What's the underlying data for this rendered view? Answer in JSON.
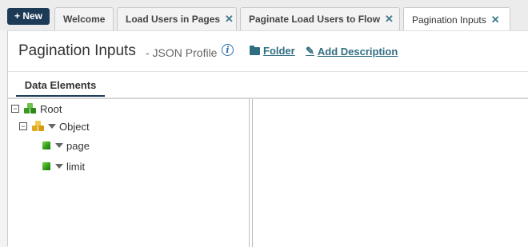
{
  "toolbar": {
    "new_label": "+ New"
  },
  "tabs": [
    {
      "label": "Welcome",
      "closable": false
    },
    {
      "label": "Load Users in Pages",
      "closable": true
    },
    {
      "label": "Paginate Load Users to Flow",
      "closable": true
    },
    {
      "label": "Pagination Inputs",
      "closable": true,
      "active": true
    }
  ],
  "close_glyph": "✕",
  "header": {
    "title": "Pagination Inputs",
    "subtitle": "- JSON Profile",
    "info_glyph": "i",
    "folder_link": "Folder",
    "add_description_link": "Add Description"
  },
  "subtabs": [
    {
      "label": "Data Elements"
    }
  ],
  "tree": {
    "root": {
      "label": "Root",
      "icon": "green-cubes-icon",
      "expanded": true
    },
    "object": {
      "label": "Object",
      "icon": "yellow-cubes-icon",
      "expanded": true
    },
    "fields": [
      {
        "label": "page",
        "icon": "green-cube-icon"
      },
      {
        "label": "limit",
        "icon": "green-cube-icon"
      }
    ],
    "collapse_glyph": "−"
  },
  "colors": {
    "new_button": "#1d3a57",
    "link": "#2f6d80",
    "active_underline": "#1d3a57",
    "close_icon": "#3d7a8a"
  }
}
